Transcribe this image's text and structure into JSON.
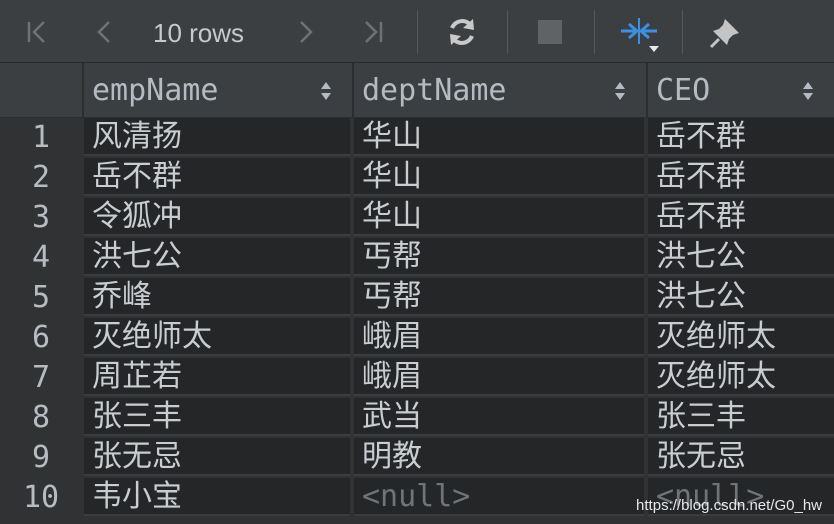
{
  "toolbar": {
    "rows_label": "10 rows",
    "buttons": [
      "first-page-icon",
      "previous-page-icon",
      "next-page-icon",
      "last-page-icon",
      "reload-icon",
      "stop-icon",
      "compare-icon",
      "pin-icon"
    ]
  },
  "table": {
    "columns": [
      "empName",
      "deptName",
      "CEO"
    ],
    "rows": [
      {
        "num": "1",
        "empName": "风清扬",
        "deptName": "华山",
        "CEO": "岳不群"
      },
      {
        "num": "2",
        "empName": "岳不群",
        "deptName": "华山",
        "CEO": "岳不群"
      },
      {
        "num": "3",
        "empName": "令狐冲",
        "deptName": "华山",
        "CEO": "岳不群"
      },
      {
        "num": "4",
        "empName": "洪七公",
        "deptName": "丐帮",
        "CEO": "洪七公"
      },
      {
        "num": "5",
        "empName": "乔峰",
        "deptName": "丐帮",
        "CEO": "洪七公"
      },
      {
        "num": "6",
        "empName": "灭绝师太",
        "deptName": "峨眉",
        "CEO": "灭绝师太"
      },
      {
        "num": "7",
        "empName": "周芷若",
        "deptName": "峨眉",
        "CEO": "灭绝师太"
      },
      {
        "num": "8",
        "empName": "张三丰",
        "deptName": "武当",
        "CEO": "张三丰"
      },
      {
        "num": "9",
        "empName": "张无忌",
        "deptName": "明教",
        "CEO": "张无忌"
      },
      {
        "num": "10",
        "empName": "韦小宝",
        "deptName": "<null>",
        "CEO": "<null>"
      }
    ]
  },
  "watermark": "https://blog.csdn.net/G0_hw",
  "colors": {
    "toolbar_bg": "#3c3f41",
    "grid_bg": "#252628",
    "compare_accent": "#3d8fe0"
  }
}
